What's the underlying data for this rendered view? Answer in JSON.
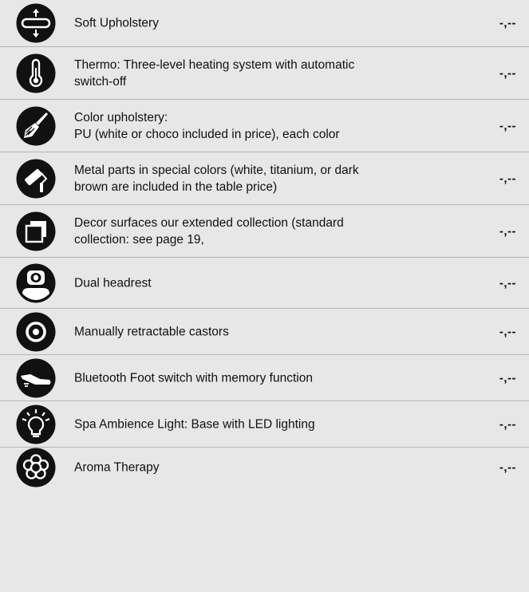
{
  "items": [
    {
      "label": "Soft Upholstery",
      "price": "-,--",
      "icon": "upholstery-adjust-icon"
    },
    {
      "label": "Thermo: Three-level heating system with automatic\nswitch-off",
      "price": "-,--",
      "icon": "thermometer-icon"
    },
    {
      "label": "Color upholstery:\nPU (white or choco included in price), each color",
      "price": "-,--",
      "icon": "paintbrush-icon"
    },
    {
      "label": "Metal parts in special colors (white, titanium, or dark\nbrown are included in the table price)",
      "price": "-,--",
      "icon": "paint-roller-icon"
    },
    {
      "label": "Decor surfaces  our extended collection (standard\ncollection: see page 19,",
      "price": "-,--",
      "icon": "decor-squares-icon"
    },
    {
      "label": "Dual headrest",
      "price": "-,--",
      "icon": "headrest-icon"
    },
    {
      "label": "Manually retractable castors",
      "price": "-,--",
      "icon": "castor-icon"
    },
    {
      "label": "Bluetooth Foot switch with memory function",
      "price": "-,--",
      "icon": "foot-switch-icon"
    },
    {
      "label": "Spa Ambience Light: Base with LED lighting",
      "price": "-,--",
      "icon": "light-bulb-icon"
    },
    {
      "label": "Aroma Therapy",
      "price": "-,--",
      "icon": "flower-icon"
    }
  ]
}
